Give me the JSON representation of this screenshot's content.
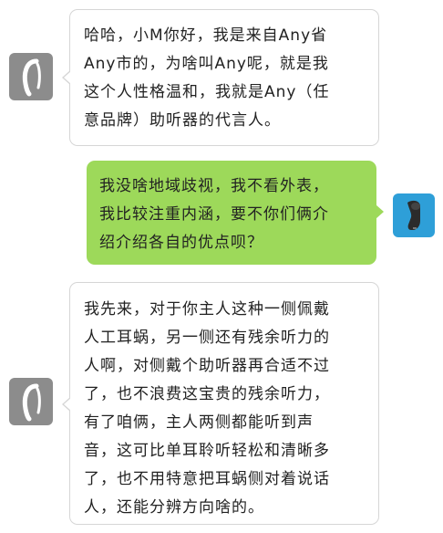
{
  "chat": {
    "messages": [
      {
        "sender": "assistant",
        "avatar_icon": "hearing-aid-icon",
        "lines": [
          "哈哈，小M你好，我是来自Any省",
          "Any市的，为啥叫Any呢，就是我",
          "这个人性格温和，我就是Any（任",
          "意品牌）助听器的代言人。"
        ]
      },
      {
        "sender": "user",
        "avatar_icon": "cochlear-implant-icon",
        "lines": [
          "我没啥地域歧视，我不看外表，",
          "我比较注重内涵，要不你们俩介",
          "绍介绍各自的优点呗？"
        ]
      },
      {
        "sender": "assistant",
        "avatar_icon": "hearing-aid-icon",
        "lines": [
          "我先来，对于你主人这种一侧佩戴",
          "人工耳蜗，另一侧还有残余听力的",
          "人啊，对侧戴个助听器再合适不过",
          "了，也不浪费这宝贵的残余听力，",
          "有了咱俩，主人两侧都能听到声",
          "音，这可比单耳聆听轻松和清晰多",
          "了，也不用特意把耳蜗侧对着说话",
          "人，还能分辨方向啥的。"
        ]
      }
    ]
  },
  "colors": {
    "user_bubble": "#9dd95a",
    "assistant_bubble": "#ffffff",
    "assistant_avatar_bg": "#8c8c8c",
    "user_avatar_bg": "#2e9fd8"
  }
}
